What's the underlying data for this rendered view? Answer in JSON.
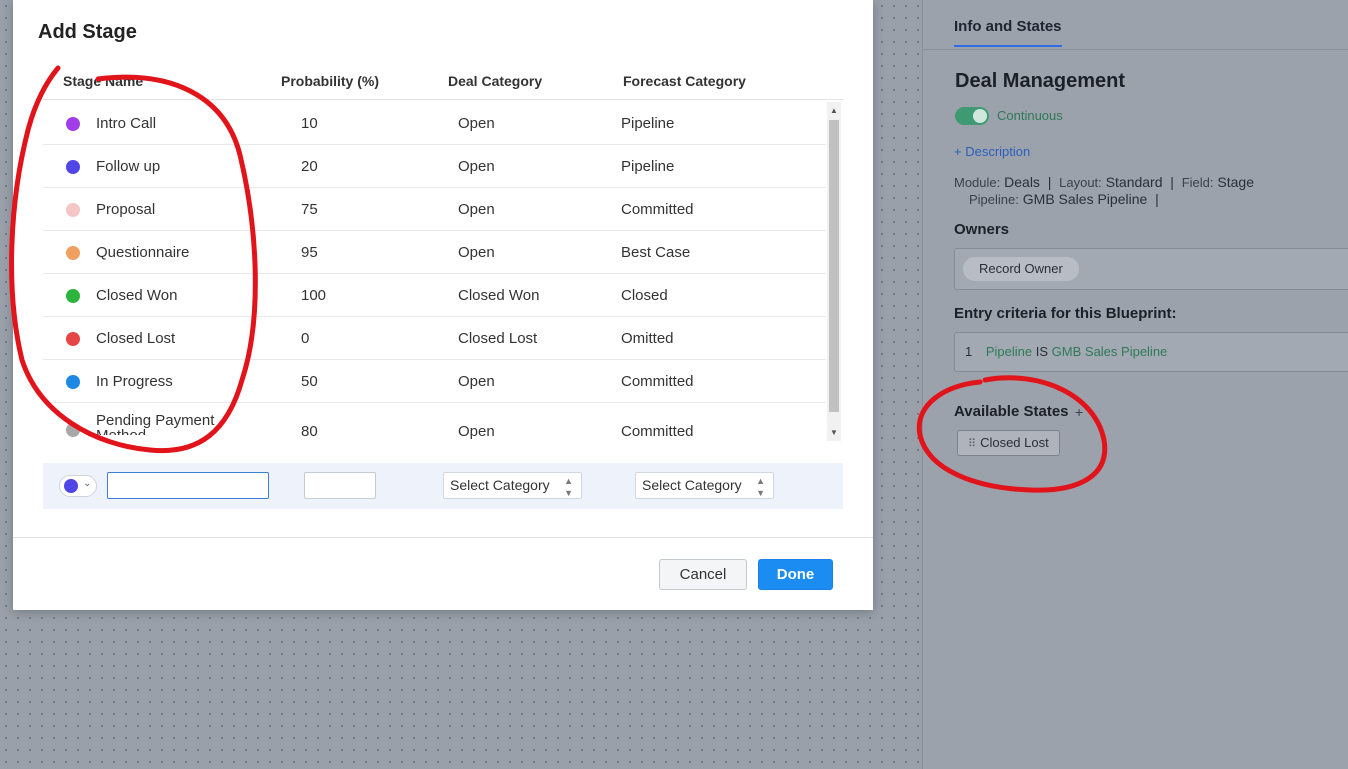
{
  "side_panel": {
    "tab": "Info and States",
    "title": "Deal Management",
    "toggle_label": "Continuous",
    "description_link": "+ Description",
    "meta": {
      "module_key": "Module:",
      "module_val": "Deals",
      "layout_key": "Layout:",
      "layout_val": "Standard",
      "field_key": "Field:",
      "field_val": "Stage",
      "pipeline_key": "Pipeline:",
      "pipeline_val": "GMB Sales Pipeline",
      "sep": "|"
    },
    "owners_label": "Owners",
    "owner_chip": "Record Owner",
    "criteria_label": "Entry criteria for this Blueprint:",
    "criteria": {
      "num": "1",
      "field": "Pipeline",
      "op": "IS",
      "value": "GMB Sales Pipeline"
    },
    "available_states_label": "Available States",
    "add_state_icon": "+",
    "available_state": "Closed Lost"
  },
  "modal": {
    "title": "Add Stage",
    "columns": [
      "Stage Name",
      "Probability (%)",
      "Deal Category",
      "Forecast Category"
    ],
    "rows": [
      {
        "name": "Intro Call",
        "probability": "10",
        "deal": "Open",
        "forecast": "Pipeline",
        "color": "#a13ee8"
      },
      {
        "name": "Follow up",
        "probability": "20",
        "deal": "Open",
        "forecast": "Pipeline",
        "color": "#5046e5"
      },
      {
        "name": "Proposal",
        "probability": "75",
        "deal": "Open",
        "forecast": "Committed",
        "color": "#f6c6c6"
      },
      {
        "name": "Questionnaire",
        "probability": "95",
        "deal": "Open",
        "forecast": "Best Case",
        "color": "#f2a062"
      },
      {
        "name": "Closed Won",
        "probability": "100",
        "deal": "Closed Won",
        "forecast": "Closed",
        "color": "#2db43d"
      },
      {
        "name": "Closed Lost",
        "probability": "0",
        "deal": "Closed Lost",
        "forecast": "Omitted",
        "color": "#e64545"
      },
      {
        "name": "In Progress",
        "probability": "50",
        "deal": "Open",
        "forecast": "Committed",
        "color": "#1e88e5"
      },
      {
        "name": "Pending Payment Method",
        "probability": "80",
        "deal": "Open",
        "forecast": "Committed",
        "color": "#a8a8a8"
      }
    ],
    "new_row": {
      "name_value": "",
      "probability_value": "",
      "deal_select": "Select Category",
      "forecast_select": "Select Category",
      "color": "#5046e5"
    },
    "cancel_label": "Cancel",
    "done_label": "Done"
  }
}
